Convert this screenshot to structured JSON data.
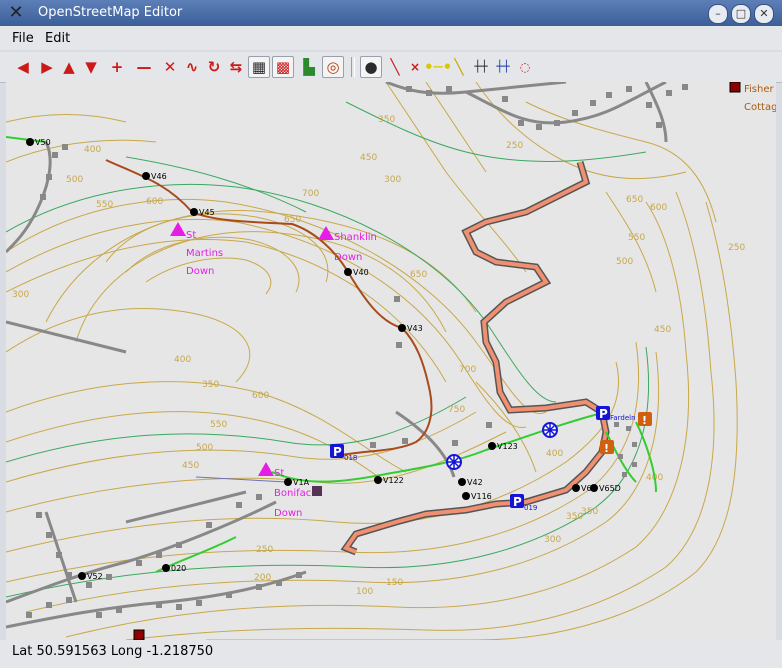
{
  "window": {
    "title": "OpenStreetMap Editor"
  },
  "menu": {
    "file": "File",
    "edit": "Edit"
  },
  "status": {
    "text": "Lat 50.591563 Long -1.218750"
  },
  "colors": {
    "contour_brown": "#c8a84a",
    "contour_green": "#3aa860",
    "track": "#a84a1c",
    "road": "#f09070",
    "path": "#33cc33",
    "peak": "#e41ee4",
    "node": "#000000",
    "segment": "#888888"
  },
  "map": {
    "contour_labels": [
      "400",
      "500",
      "550",
      "600",
      "650",
      "700",
      "350",
      "300",
      "250",
      "450",
      "400",
      "350",
      "650",
      "700",
      "750",
      "600",
      "550",
      "500",
      "450",
      "400",
      "350",
      "300",
      "250",
      "200",
      "150",
      "100",
      "650",
      "600",
      "550",
      "500",
      "450",
      "400",
      "350",
      "300",
      "250"
    ],
    "nodes": [
      "V50",
      "V46",
      "V45",
      "V40",
      "V43",
      "V123",
      "V42",
      "V116",
      "V122",
      "V1A",
      "V6",
      "V65D",
      "V52",
      "020"
    ],
    "peaks": [
      {
        "lines": [
          "St",
          "Martins",
          "Down"
        ]
      },
      {
        "lines": [
          "Shanklin",
          "Down"
        ]
      },
      {
        "lines": [
          "St",
          "Boniface",
          "Down"
        ]
      }
    ],
    "parking": [
      {
        "label": "018"
      },
      {
        "label": "019"
      },
      {
        "label": "Fardeln"
      }
    ],
    "place": {
      "lines": [
        "Fisher",
        "Cottag"
      ]
    }
  }
}
